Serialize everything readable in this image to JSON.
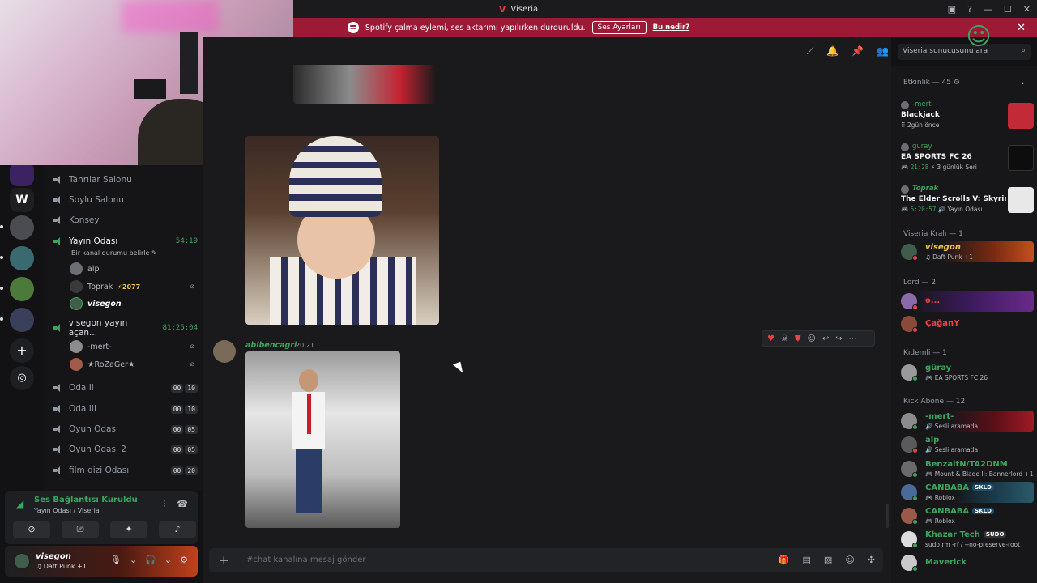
{
  "window": {
    "title": "Viseria"
  },
  "banner": {
    "text": "Spotify çalma eylemi, ses aktarımı yapılırken durduruldu.",
    "button": "Ses Ayarları",
    "link": "Bu nedir?"
  },
  "search": {
    "placeholder": "Viseria sunucusunu ara"
  },
  "channels": [
    {
      "name": "Tanrılar Salonu"
    },
    {
      "name": "Soylu Salonu"
    },
    {
      "name": "Konsey"
    },
    {
      "name": "Yayın Odası",
      "time": "54:19",
      "status": "Bir kanal durumu belirle",
      "users": [
        "alp",
        "Toprak",
        "visegon"
      ],
      "boost": "2077"
    },
    {
      "name": "visegon yayın açan...",
      "time": "81:25:04",
      "users": [
        "-mert-",
        "★RoZaGer★"
      ]
    },
    {
      "name": "Oda II",
      "count": [
        "00",
        "10"
      ]
    },
    {
      "name": "Oda III",
      "count": [
        "00",
        "10"
      ]
    },
    {
      "name": "Oyun Odası",
      "count": [
        "00",
        "05"
      ]
    },
    {
      "name": "Oyun Odası 2",
      "count": [
        "00",
        "05"
      ]
    },
    {
      "name": "film dizi Odası",
      "count": [
        "00",
        "20"
      ]
    }
  ],
  "voice": {
    "status": "Ses Bağlantısı Kuruldu",
    "location": "Yayın Odası / Viseria"
  },
  "user": {
    "name": "visegon",
    "activity": "Daft Punk +1"
  },
  "message": {
    "author": "abibencagri",
    "time": "20:21"
  },
  "composer": {
    "placeholder": "#chat kanalına mesaj gönder"
  },
  "members": {
    "activity_header": "Etkinlik — 45",
    "activities": [
      {
        "user": "-mert-",
        "game": "Blackjack",
        "meta": "2gün önce",
        "time": ""
      },
      {
        "user": "güray",
        "game": "EA SPORTS FC 26",
        "time": "21:28",
        "meta": "3 günlük Seri"
      },
      {
        "user": "Toprak",
        "game": "The Elder Scrolls V: Skyrim ...",
        "time": "5:20:57",
        "meta": "Yayın Odası"
      }
    ],
    "groups": [
      {
        "title": "Viseria Kralı — 1",
        "items": [
          {
            "name": "visegon",
            "sub": "Daft Punk +1"
          }
        ]
      },
      {
        "title": "Lord — 2",
        "items": [
          {
            "name": "ə...",
            "sub": ""
          },
          {
            "name": "ÇağanY",
            "sub": ""
          }
        ]
      },
      {
        "title": "Kıdemli — 1",
        "items": [
          {
            "name": "güray",
            "sub": "EA SPORTS FC 26"
          }
        ]
      },
      {
        "title": "Kick Abone — 12",
        "items": [
          {
            "name": "-mert-",
            "sub": "Sesli aramada"
          },
          {
            "name": "alp",
            "sub": "Sesli aramada"
          },
          {
            "name": "BenzaitN/TA2DNM",
            "sub": "Mount & Blade II: Bannerlord +1"
          },
          {
            "name": "CANBABA",
            "sub": "Roblox",
            "tag": "SKLD"
          },
          {
            "name": "CANBABA",
            "sub": "Roblox",
            "tag": "SKLD"
          },
          {
            "name": "Khazar Tech",
            "sub": "sudo rm -rf / --no-preserve-root",
            "tag": "SUDO"
          },
          {
            "name": "Maverick",
            "sub": ""
          }
        ]
      }
    ]
  },
  "colors": {
    "accent": "#3ba55c",
    "banner": "#9c1a36",
    "danger": "#ed4245"
  }
}
